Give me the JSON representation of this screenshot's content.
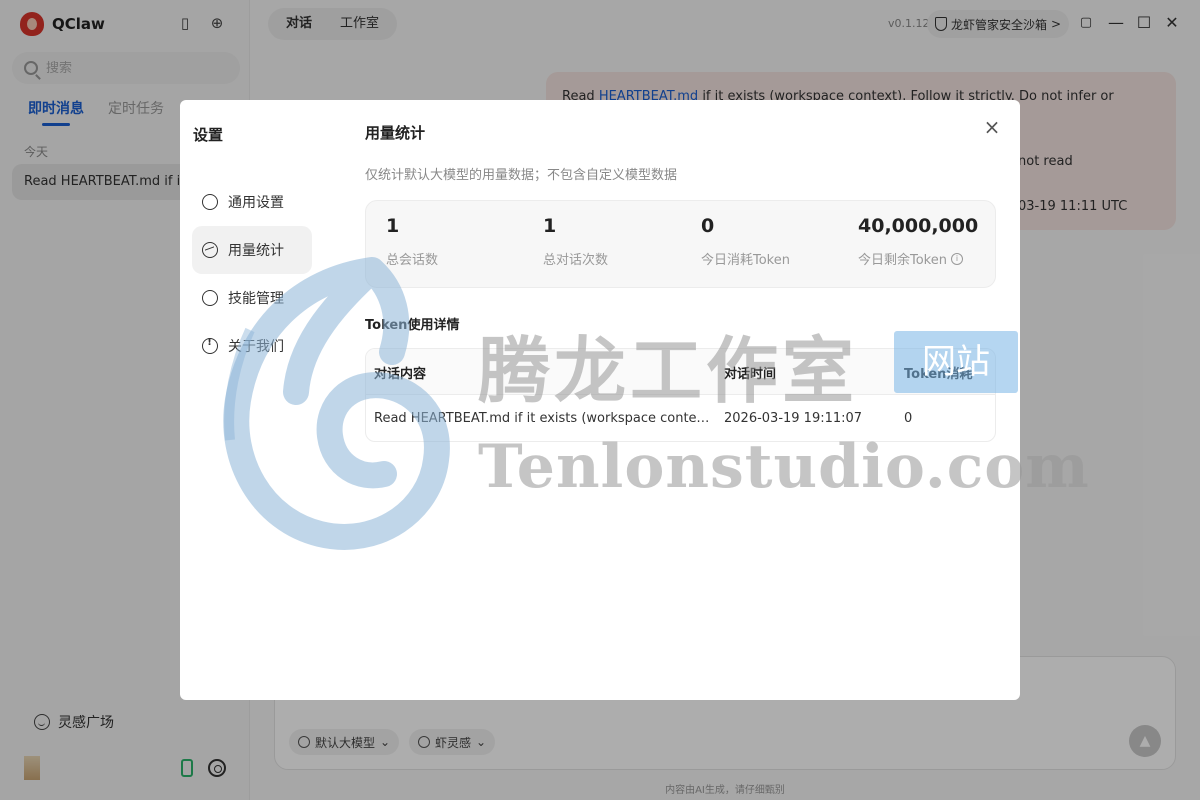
{
  "app": {
    "name": "QClaw",
    "version": "v0.1.12"
  },
  "sidebar": {
    "search_placeholder": "搜索",
    "tabs": [
      {
        "label": "即时消息",
        "active": true
      },
      {
        "label": "定时任务",
        "active": false
      }
    ],
    "section_label": "今天",
    "sessions": [
      {
        "title": "Read HEARTBEAT.md if it"
      }
    ],
    "inspiration_label": "灵感广场",
    "icons": {
      "sidebar_toggle": "sidebar-toggle-icon",
      "new_chat": "new-chat-icon",
      "settings": "gear-icon",
      "mobile": "phone-icon"
    }
  },
  "header": {
    "tabs": [
      {
        "label": "对话",
        "active": true
      },
      {
        "label": "工作室",
        "active": false
      }
    ],
    "sandbox_label": "龙虾管家安全沙箱",
    "sandbox_chevron": ">"
  },
  "chat": {
    "line1_prefix": "Read ",
    "line1_link": "HEARTBEAT.md",
    "line1_suffix": " if it exists (workspace context). Follow it strictly. Do not infer or repeat old",
    "frag_notread": "not read",
    "frag_time": "03-19 11:11 UTC"
  },
  "composer": {
    "model_chip": "默认大模型",
    "inspire_chip": "虾灵感",
    "disclaimer": "内容由AI生成，请仔细甄别"
  },
  "modal": {
    "title": "设置",
    "nav": [
      {
        "label": "通用设置",
        "icon": "gear-icon",
        "active": false
      },
      {
        "label": "用量统计",
        "icon": "chart-icon",
        "active": true
      },
      {
        "label": "技能管理",
        "icon": "skill-icon",
        "active": false
      },
      {
        "label": "关于我们",
        "icon": "info-icon",
        "active": false
      }
    ],
    "panel_title": "用量统计",
    "panel_subtitle": "仅统计默认大模型的用量数据；不包含自定义模型数据",
    "stats": [
      {
        "value": "1",
        "label": "总会话数"
      },
      {
        "value": "1",
        "label": "总对话次数"
      },
      {
        "value": "0",
        "label": "今日消耗Token"
      },
      {
        "value": "40,000,000",
        "label": "今日剩余Token"
      }
    ],
    "table_title": "Token使用详情",
    "table": {
      "headers": [
        "对话内容",
        "对话时间",
        "Token消耗"
      ],
      "rows": [
        [
          "Read HEARTBEAT.md if it exists (workspace context)....",
          "2026-03-19 19:11:07",
          "0"
        ]
      ]
    },
    "close_symbol": "×"
  },
  "watermark": {
    "cn": "腾龙工作室",
    "site": "网站",
    "en": "Tenlonstudio.com"
  },
  "colors": {
    "accent": "#1a5fd1",
    "overlay": "rgba(0,0,0,0.32)",
    "bubble": "#f3e3e0"
  }
}
